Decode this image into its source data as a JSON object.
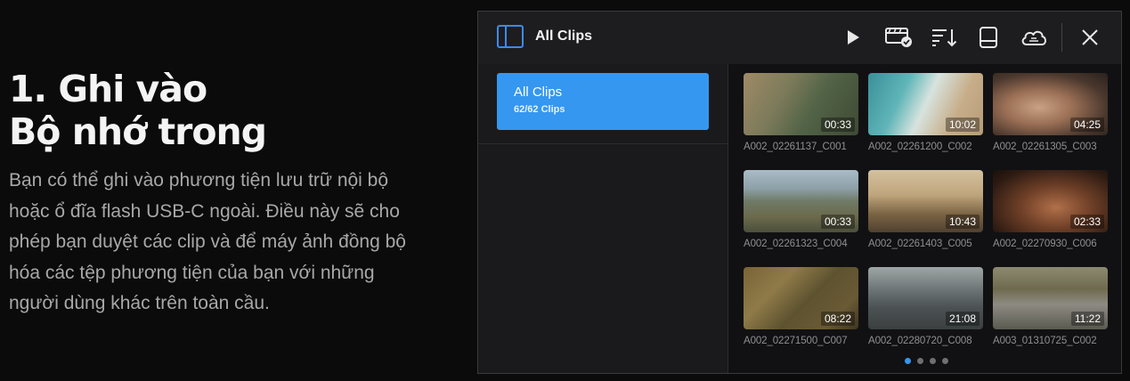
{
  "heading": {
    "line1": "1. Ghi vào",
    "line2": "Bộ nhớ trong"
  },
  "description": "Bạn có thể ghi vào phương tiện lưu trữ nội bộ hoặc ổ đĩa flash USB-C ngoài. Điều này sẽ cho phép bạn duyệt các clip và để máy ảnh đồng bộ hóa các tệp phương tiện của bạn với những người dùng khác trên toàn cầu.",
  "window": {
    "title": "All Clips",
    "toolbar_icons": [
      "play-icon",
      "clip-verified-icon",
      "sort-icon",
      "drive-icon",
      "cloud-icon",
      "close-icon"
    ]
  },
  "sidebar": {
    "album": {
      "name": "All Clips",
      "count": "62/62 Clips"
    }
  },
  "clips": [
    {
      "name": "A002_02261137_C001",
      "duration": "00:33"
    },
    {
      "name": "A002_02261200_C002",
      "duration": "10:02"
    },
    {
      "name": "A002_02261305_C003",
      "duration": "04:25"
    },
    {
      "name": "A002_02261323_C004",
      "duration": "00:33"
    },
    {
      "name": "A002_02261403_C005",
      "duration": "10:43"
    },
    {
      "name": "A002_02270930_C006",
      "duration": "02:33"
    },
    {
      "name": "A002_02271500_C007",
      "duration": "08:22"
    },
    {
      "name": "A002_02280720_C008",
      "duration": "21:08"
    },
    {
      "name": "A003_01310725_C002",
      "duration": "11:22"
    }
  ],
  "pagination": {
    "pages": 4,
    "current": 1
  },
  "colors": {
    "accent": "#3597ef",
    "background": "#0b0b0c",
    "window": "#1a1a1c"
  }
}
